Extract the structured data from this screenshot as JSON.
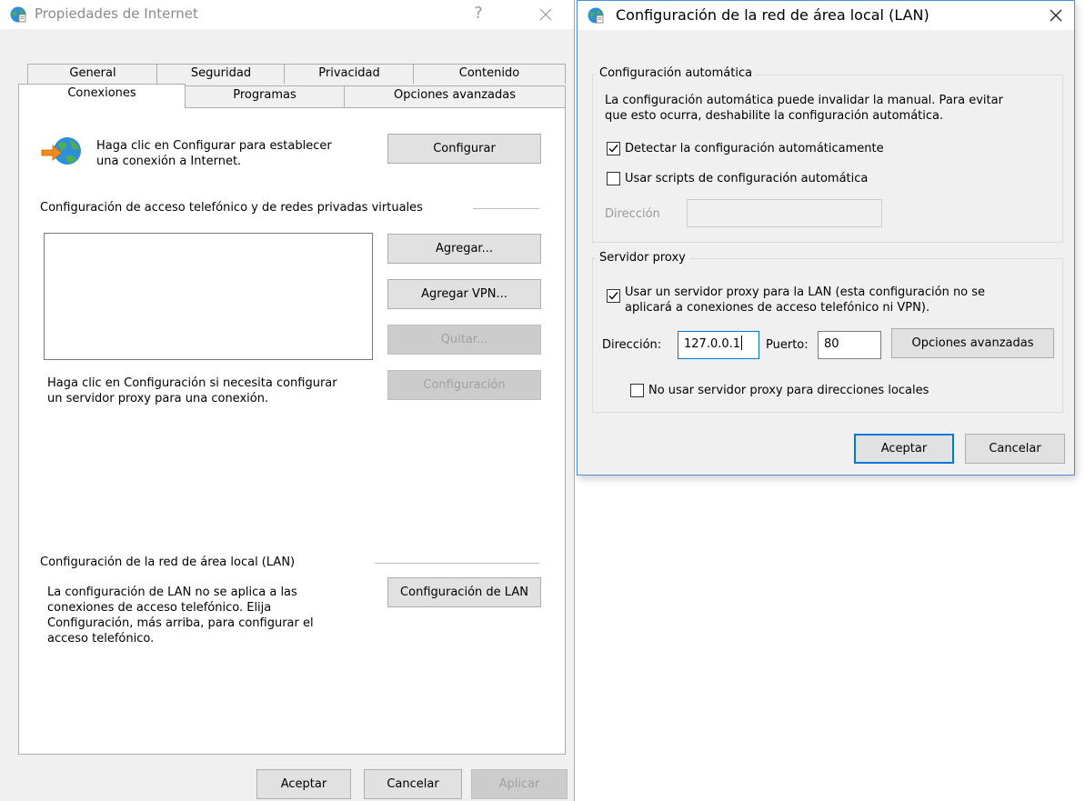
{
  "internet_options": {
    "title": "Propiedades de Internet",
    "help_button": "?",
    "tabs_row1": [
      "General",
      "Seguridad",
      "Privacidad",
      "Contenido"
    ],
    "tabs_row2": [
      "Conexiones",
      "Programas",
      "Opciones avanzadas"
    ],
    "selected_tab": "Conexiones",
    "setup_text": [
      "Haga clic en Configurar para establecer",
      "una conexión a Internet."
    ],
    "setup_button": "Configurar",
    "dialup_header": "Configuración de acceso telefónico y de redes privadas virtuales",
    "add_button": "Agregar...",
    "add_vpn_button": "Agregar VPN...",
    "remove_button": "Quitar...",
    "proxy_text": [
      "Haga clic en Configuración si necesita configurar",
      "un servidor proxy para una conexión."
    ],
    "settings_button": "Configuración",
    "lan_header": "Configuración de la red de área local (LAN)",
    "lan_text": [
      "La configuración de LAN no se aplica a las",
      "conexiones de acceso telefónico. Elija",
      "Configuración, más arriba, para configurar el",
      "acceso telefónico."
    ],
    "lan_button": "Configuración de LAN",
    "ok_button": "Aceptar",
    "cancel_button": "Cancelar",
    "apply_button": "Aplicar"
  },
  "lan_settings": {
    "title": "Configuración de la red de área local (LAN)",
    "auto_group": "Configuración automática",
    "auto_desc": [
      "La configuración automática puede invalidar la manual. Para evitar",
      "que esto ocurra, deshabilite la configuración automática."
    ],
    "auto_detect_label": "Detectar la configuración automáticamente",
    "auto_detect_checked": true,
    "use_script_label": "Usar scripts de configuración automática",
    "use_script_checked": false,
    "script_address_label": "Dirección",
    "script_address_value": "",
    "proxy_group": "Servidor proxy",
    "use_proxy_label": [
      "Usar un servidor proxy para la LAN (esta configuración no se",
      "aplicará a conexiones de acceso telefónico ni VPN)."
    ],
    "use_proxy_checked": true,
    "address_label": "Dirección:",
    "address_value": "127.0.0.1",
    "port_label": "Puerto:",
    "port_value": "80",
    "advanced_button": "Opciones avanzadas",
    "bypass_local_label": "No usar servidor proxy para direcciones locales",
    "bypass_local_checked": false,
    "ok_button": "Aceptar",
    "cancel_button": "Cancelar"
  },
  "icons": [
    "ie-globe-icon",
    "close-icon",
    "help-icon",
    "connect-wizard-icon",
    "checkmark-icon"
  ],
  "colors": {
    "accent": "#0078d7",
    "dialog_bg": "#f0f0f0",
    "button_bg": "#e1e1e1",
    "disabled_text": "#a0a0a0"
  }
}
